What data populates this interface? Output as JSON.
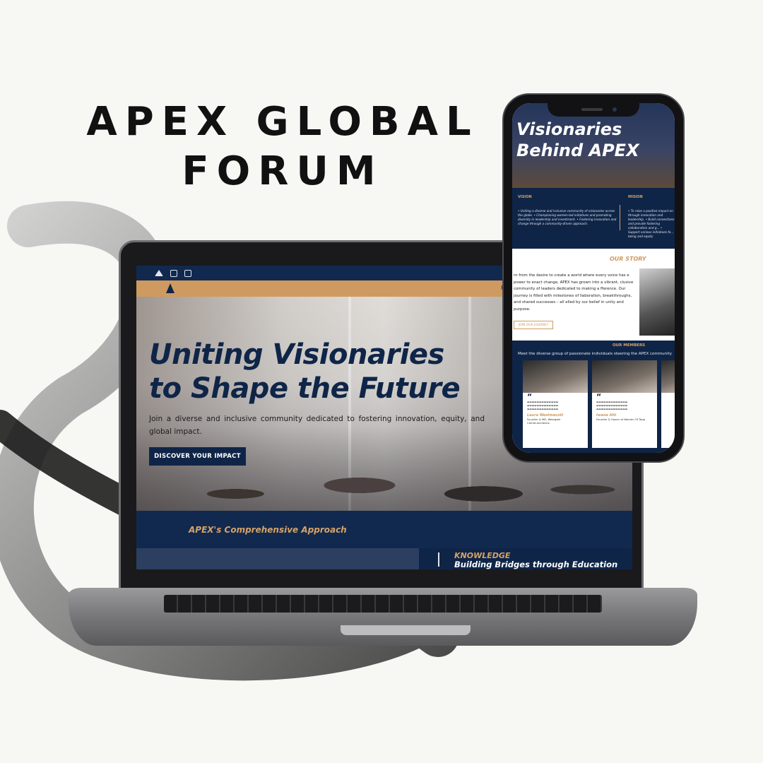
{
  "headline": {
    "line1": "APEX GLOBAL",
    "line2": "FORUM"
  },
  "laptop": {
    "social_icons": [
      "twitter-icon",
      "instagram-icon",
      "linkedin-icon"
    ],
    "nav_partial": "H",
    "hero": {
      "title_line1": "Uniting Visionaries",
      "title_line2": "to Shape the Future",
      "subtitle": "Join a diverse and inclusive community dedicated to fostering innovation, equity, and global impact.",
      "button": "DISCOVER YOUR IMPACT"
    },
    "approach_title": "APEX's Comprehensive Approach",
    "knowledge": {
      "label": "KNOWLEDGE",
      "tagline": "Building Bridges through Education"
    }
  },
  "phone": {
    "hero_title_line1": "Visionaries",
    "hero_title_line2": "Behind APEX",
    "vision_heading": "VISION",
    "mission_heading": "MISION",
    "vision_text": "• Uniting a diverse and inclusive community of visionaries across the globe. • Championing women-led initiatives and promoting diversity in leadership and investment. • Fostering innovation and change through a community-driven approach.",
    "mission_text": "• To raise a positive impact on through innovation and leadership. • Build connections and provide fostering collaboration and g... • Support various initiatives fo... being and equity",
    "story_heading": "OUR STORY",
    "story_text": "rn from the desire to create a world where every voice has e power to enact change, APEX has grown into a vibrant, clusive community of leaders dedicated to making a fference. Our journey is filled with milestones of llaboration, breakthroughs, and shared successes – all elled by our belief in unity and purpose.",
    "story_button": "JOIN OUR JOURNEY",
    "members_heading": "OUR MEMBERS",
    "members_sub": "Meet the diverse group of passionate individuals steering the APEX community",
    "members": [
      {
        "name": "Laura Westmacott",
        "role": "Founder & MD, Westgate Communications"
      },
      {
        "name": "Iwana Alti",
        "role": "Founder & Owner of Women Of Topp"
      }
    ]
  },
  "colors": {
    "navy": "#0f2548",
    "gold": "#cf9a60",
    "background": "#f7f7f3"
  }
}
